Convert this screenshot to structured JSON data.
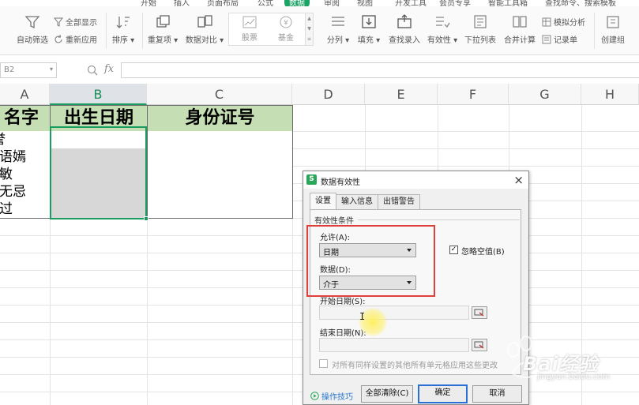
{
  "menu": {
    "tabs": [
      "开始",
      "插入",
      "页面布局",
      "公式",
      "数据",
      "审阅",
      "视图",
      "开发工具",
      "会员专享",
      "智能工具箱"
    ],
    "active": "数据",
    "search": "查找命令、搜索模板"
  },
  "ribbon": {
    "auto_filter": "自动筛选",
    "show_all": "全部显示",
    "reapply": "重新应用",
    "sort": "排序",
    "dedupe": "重复项",
    "compare": "数据对比",
    "stock": "股票",
    "fund": "基金",
    "split": "分列",
    "fill": "填充",
    "find_enter": "查找录入",
    "validity": "有效性",
    "dropdown_list": "下拉列表",
    "consolidate": "合并计算",
    "what_if": "模拟分析",
    "record_form": "记录单",
    "create_group": "创建组"
  },
  "formula_bar": {
    "cell_ref": "B2",
    "fx": "fx",
    "value": ""
  },
  "columns": [
    "A",
    "B",
    "C",
    "D",
    "E",
    "F",
    "G",
    "H"
  ],
  "sheet": {
    "header_a": "名字",
    "header_b": "出生日期",
    "header_c": "身份证号",
    "names": [
      "李誉",
      "王语嫣",
      "赵敏",
      "张无忌",
      "杨过"
    ]
  },
  "dialog": {
    "title": "数据有效性",
    "tabs": [
      "设置",
      "输入信息",
      "出错警告"
    ],
    "active_tab": "设置",
    "group_label": "有效性条件",
    "allow_label": "允许(A):",
    "allow_value": "日期",
    "data_label": "数据(D):",
    "data_value": "介于",
    "ignore_blank": "忽略空值(B)",
    "ignore_blank_checked": true,
    "start_label": "开始日期(S):",
    "end_label": "结束日期(N):",
    "apply_all": "对所有同样设置的其他所有单元格应用这些更改",
    "tips": "操作技巧",
    "clear_all": "全部清除(C)",
    "ok": "确定",
    "cancel": "取消"
  },
  "watermark": {
    "brand": "Bai经验",
    "url": "jingyan.baidu.com"
  },
  "colors": {
    "accent_green": "#1a9c60",
    "header_fill": "#c6deb4",
    "selected_fill": "#d7d7d7",
    "highlight_red": "#e0403b"
  }
}
